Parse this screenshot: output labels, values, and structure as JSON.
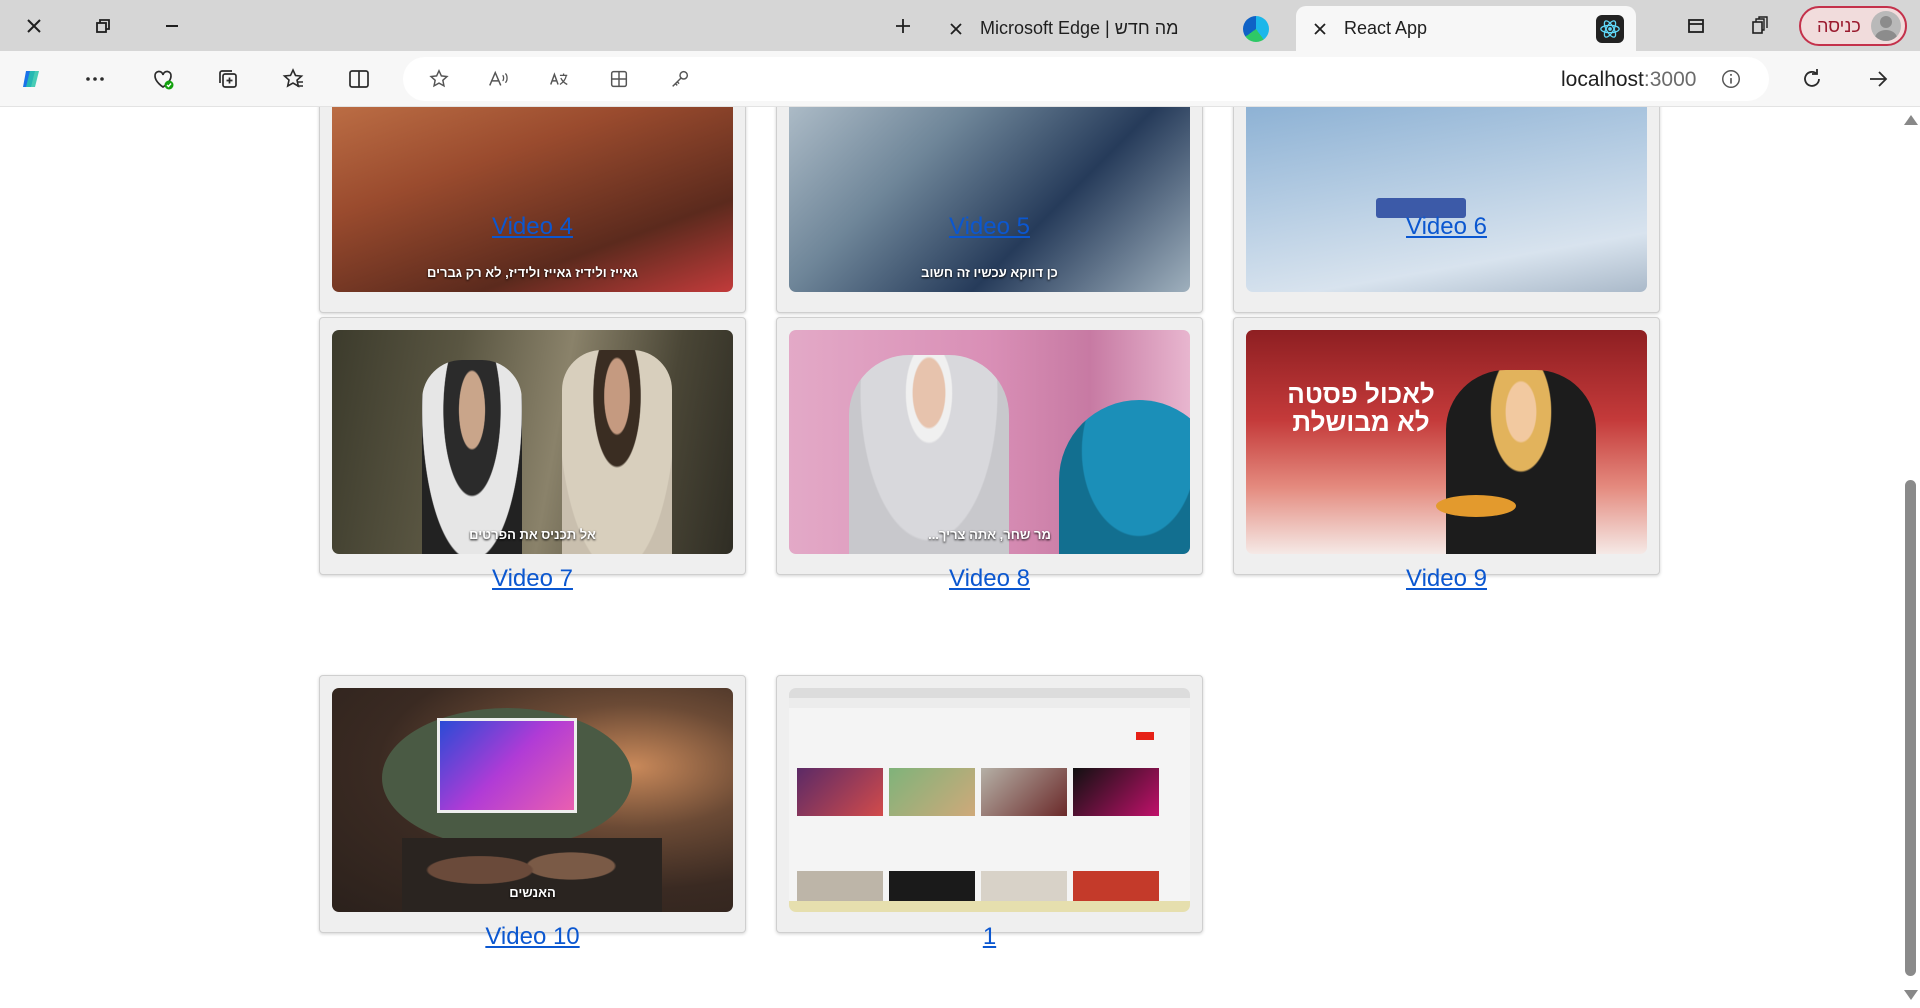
{
  "browser": {
    "tabs": [
      {
        "title": "Microsoft Edge | מה חדש",
        "active": false
      },
      {
        "title": "React App",
        "active": true
      }
    ],
    "profile_label": "כניסה",
    "url_host": "localhost",
    "url_port": ":3000"
  },
  "icons": {
    "close": "close-icon",
    "new_tab": "plus-icon",
    "restore": "restore-icon",
    "minimize": "minimize-icon"
  },
  "cards": [
    {
      "label": "Video 4",
      "subtitle": "גאייז ולידיז גאייז ולידיז, לא רק גברים"
    },
    {
      "label": "Video 5",
      "subtitle": "כן דווקא עכשיו זה חשוב"
    },
    {
      "label": "Video 6",
      "subtitle": ""
    },
    {
      "label": "Video 7",
      "subtitle": "אל תכניס את הפרטים"
    },
    {
      "label": "Video 8",
      "subtitle": "מר שחר, אתה צריך..."
    },
    {
      "label": "Video 9",
      "subtitle": "לאכול פסטה לא מבושלת"
    },
    {
      "label": "Video 10",
      "subtitle": "האנשים"
    },
    {
      "label": "1",
      "subtitle": ""
    }
  ],
  "colors": {
    "link": "#0b57d0",
    "card_bg": "#efefef",
    "profile_border": "#c4314b"
  }
}
